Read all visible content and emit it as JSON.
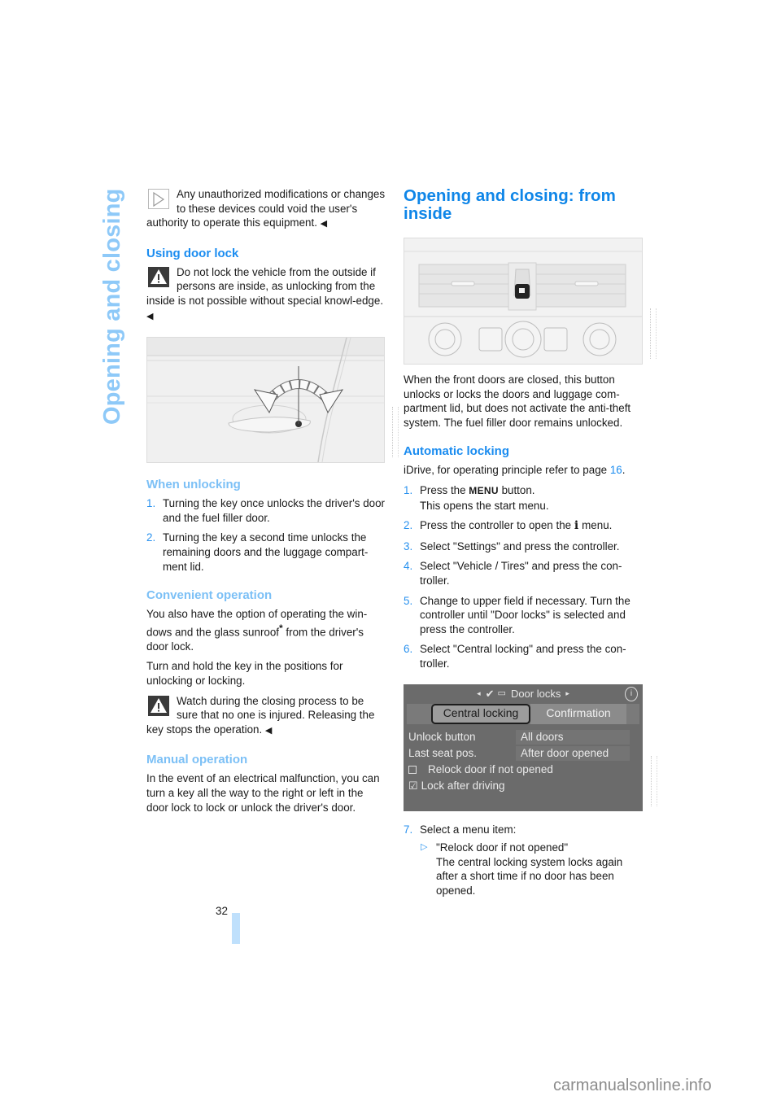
{
  "sidebar": {
    "chapter_title": "Opening and closing"
  },
  "left_column": {
    "note_intro": {
      "icon": "note-triangle-icon",
      "text": "Any unauthorized modifications or changes to these devices could void the user's authority to operate this equipment.",
      "end_mark": "◀"
    },
    "using_door_lock": {
      "heading": "Using door lock",
      "warning": {
        "icon": "warning-icon",
        "text": "Do not lock the vehicle from the outside if persons are inside, as unlocking from the inside is not possible without special knowl-edge.",
        "end_mark": "◀"
      },
      "figure_alt": "door-handle-key-turn-illustration"
    },
    "when_unlocking": {
      "heading": "When unlocking",
      "steps": [
        {
          "num": "1.",
          "text": "Turning the key once unlocks the driver's door and the fuel filler door."
        },
        {
          "num": "2.",
          "text": "Turning the key a second time unlocks the remaining doors and the luggage compart-ment lid."
        }
      ]
    },
    "convenient_operation": {
      "heading": "Convenient operation",
      "para1_before": "You also have the option of operating the win-dows and the glass sunroof",
      "para1_star": "*",
      "para1_after": " from the driver's door lock.",
      "para2": "Turn and hold the key in the positions for unlocking or locking.",
      "warning": {
        "icon": "warning-icon",
        "text": "Watch during the closing process to be sure that no one is injured. Releasing the key stops the operation.",
        "end_mark": "◀"
      }
    },
    "manual_operation": {
      "heading": "Manual operation",
      "text": "In the event of an electrical malfunction, you can turn a key all the way to the right or left in the door lock to lock or unlock the driver's door."
    }
  },
  "right_column": {
    "section_heading": "Opening and closing: from inside",
    "figure_alt": "center-console-lock-button-illustration",
    "intro": "When the front doors are closed, this button unlocks or locks the doors and luggage com-partment lid, but does not activate the anti-theft system. The fuel filler door remains unlocked.",
    "automatic_locking": {
      "heading": "Automatic locking",
      "ref_before": "iDrive, for operating principle refer to page ",
      "ref_page": "16",
      "ref_after": ".",
      "steps": [
        {
          "num": "1.",
          "before": "Press the ",
          "keyword": "MENU",
          "after": " button.",
          "line2": "This opens the start menu."
        },
        {
          "num": "2.",
          "before": "Press the controller to open the ",
          "keyword": "i",
          "after": " menu."
        },
        {
          "num": "3.",
          "text": "Select \"Settings\" and press the controller."
        },
        {
          "num": "4.",
          "text": "Select \"Vehicle / Tires\" and press the con-troller."
        },
        {
          "num": "5.",
          "text": "Change to upper field if necessary. Turn the controller until \"Door locks\" is selected and press the controller."
        },
        {
          "num": "6.",
          "text": "Select \"Central locking\" and press the con-troller."
        }
      ],
      "screen": {
        "title": "Door locks",
        "tabs": [
          {
            "label": "Central locking",
            "active": true
          },
          {
            "label": "Confirmation",
            "active": false
          }
        ],
        "rows": [
          {
            "label": "Unlock button",
            "value": "All doors"
          },
          {
            "label": "Last seat pos.",
            "value": "After door opened"
          }
        ],
        "checkboxes": [
          {
            "label": "Relock door if not opened",
            "checked": false
          },
          {
            "label": "Lock after driving",
            "checked": true
          }
        ]
      },
      "step7": {
        "num": "7.",
        "text": "Select a menu item:",
        "sub_items": [
          {
            "title": "\"Relock door if not opened\"",
            "desc": "The central locking system locks again after a short time if no door has been opened."
          }
        ]
      }
    }
  },
  "footer": {
    "page_number": "32",
    "watermark": "carmanualsonline.info"
  },
  "colors": {
    "heading_blue": "#1a8cf0",
    "subheading_light_blue": "#7cc0f6",
    "sidebar_blue": "#8ec9f8",
    "page_bar": "#bfe0fc"
  }
}
